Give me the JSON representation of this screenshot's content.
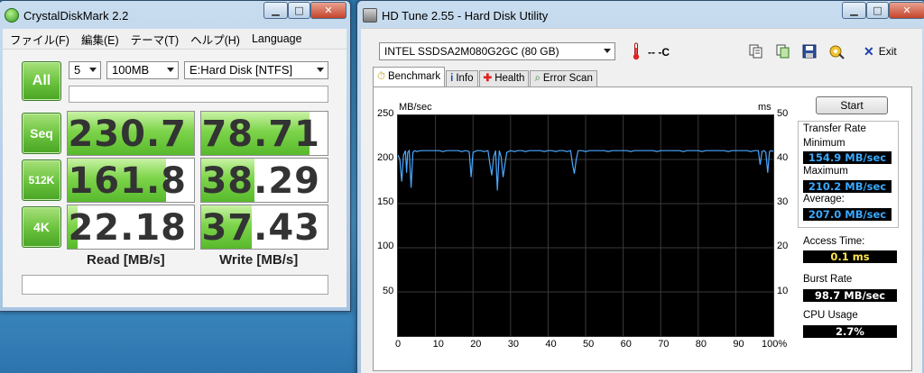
{
  "cdm": {
    "title": "CrystalDiskMark 2.2",
    "menu": [
      "ファイル(F)",
      "編集(E)",
      "テーマ(T)",
      "ヘルプ(H)",
      "Language"
    ],
    "all_label": "All",
    "count": "5",
    "size": "100MB",
    "drive": "E:Hard Disk [NTFS]",
    "rows": [
      {
        "label": "Seq",
        "read": "230.7",
        "write": "78.71",
        "read_fraction": 1.0,
        "write_fraction": 0.86
      },
      {
        "label": "512K",
        "read": "161.8",
        "write": "38.29",
        "read_fraction": 0.78,
        "write_fraction": 0.42
      },
      {
        "label": "4K",
        "read": "22.18",
        "write": "37.43",
        "read_fraction": 0.08,
        "write_fraction": 0.4
      }
    ],
    "read_header": "Read [MB/s]",
    "write_header": "Write [MB/s]"
  },
  "hdtune": {
    "title": "HD Tune 2.55 - Hard Disk Utility",
    "drive": "INTEL SSDSA2M080G2GC (80 GB)",
    "temperature": "-- -C",
    "exit_label": "Exit",
    "tabs": [
      {
        "label": "Benchmark",
        "icon": "stopwatch-icon"
      },
      {
        "label": "Info",
        "icon": "info-icon"
      },
      {
        "label": "Health",
        "icon": "health-cross-icon"
      },
      {
        "label": "Error Scan",
        "icon": "magnifier-icon"
      }
    ],
    "start_label": "Start",
    "transfer_rate_label": "Transfer Rate",
    "minimum_label": "Minimum",
    "minimum": "154.9 MB/sec",
    "maximum_label": "Maximum",
    "maximum": "210.2 MB/sec",
    "average_label": "Average:",
    "average": "207.0 MB/sec",
    "access_time_label": "Access Time:",
    "access_time": "0.1 ms",
    "burst_rate_label": "Burst Rate",
    "burst_rate": "98.7 MB/sec",
    "cpu_usage_label": "CPU Usage",
    "cpu_usage": "2.7%"
  },
  "chart_data": {
    "type": "line",
    "ylabel": "MB/sec",
    "y2label": "ms",
    "ylim": [
      0,
      250
    ],
    "y2lim": [
      0,
      50
    ],
    "yticks": [
      "250",
      "200",
      "150",
      "100",
      "50"
    ],
    "y2ticks": [
      "50",
      "40",
      "30",
      "20",
      "10"
    ],
    "xticks": [
      "0",
      "10",
      "20",
      "30",
      "40",
      "50",
      "60",
      "70",
      "80",
      "90",
      "100%"
    ],
    "xlim": [
      0,
      100
    ],
    "grid": true,
    "line_color": "#4aa8ff",
    "series": [
      {
        "x": [
          0,
          0.5,
          1,
          1.5,
          2,
          2.3,
          2.6,
          3,
          3.5,
          4,
          4.5,
          5,
          6,
          7,
          8,
          9,
          10,
          11,
          12,
          13,
          14,
          15,
          16,
          17,
          18,
          19,
          19.5,
          20,
          20.5,
          21,
          22,
          23,
          24,
          24.5,
          25,
          25.5,
          26,
          26.5,
          27,
          27.5,
          28,
          29,
          30,
          31,
          32,
          33,
          34,
          35,
          36,
          37,
          38,
          39,
          40,
          41,
          42,
          43,
          44,
          45,
          46,
          46.5,
          47,
          47.5,
          48,
          49,
          50,
          51,
          52,
          53,
          54,
          55,
          56,
          57,
          58,
          59,
          60,
          61,
          62,
          63,
          64,
          65,
          66,
          67,
          68,
          69,
          70,
          71,
          72,
          73,
          74,
          75,
          76,
          77,
          78,
          79,
          80,
          81,
          82,
          83,
          84,
          85,
          86,
          87,
          88,
          89,
          90,
          91,
          92,
          93,
          94,
          95,
          96,
          96.5,
          97,
          97.5,
          98,
          98.5,
          99,
          99.5,
          100
        ],
        "y": [
          205,
          200,
          175,
          205,
          210,
          185,
          208,
          210,
          168,
          208,
          210,
          209,
          210,
          210,
          210,
          210,
          210,
          210,
          209,
          210,
          210,
          210,
          210,
          209,
          210,
          209,
          180,
          208,
          209,
          210,
          210,
          209,
          210,
          195,
          182,
          203,
          210,
          165,
          210,
          203,
          180,
          208,
          210,
          209,
          210,
          210,
          209,
          210,
          210,
          210,
          210,
          209,
          210,
          210,
          209,
          210,
          210,
          209,
          210,
          195,
          184,
          200,
          210,
          210,
          209,
          210,
          210,
          210,
          210,
          210,
          209,
          210,
          210,
          210,
          210,
          210,
          209,
          210,
          210,
          210,
          210,
          210,
          210,
          209,
          210,
          210,
          210,
          210,
          210,
          210,
          209,
          210,
          210,
          210,
          210,
          209,
          210,
          210,
          210,
          210,
          210,
          210,
          209,
          210,
          210,
          210,
          210,
          210,
          209,
          210,
          210,
          194,
          209,
          210,
          208,
          185,
          209,
          210,
          209
        ]
      }
    ]
  }
}
